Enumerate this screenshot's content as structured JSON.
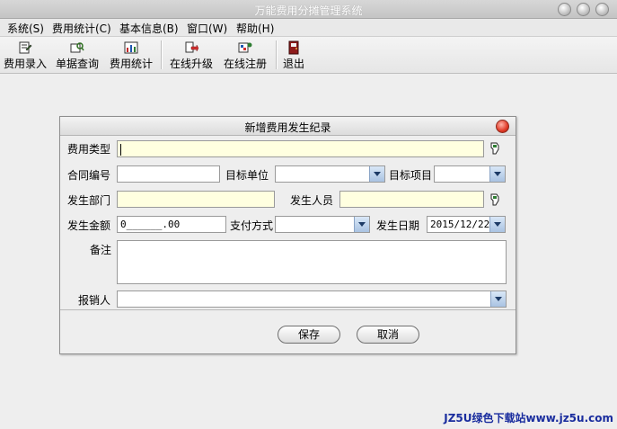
{
  "window": {
    "title": "万能费用分摊管理系统"
  },
  "menu": [
    {
      "label": "系统(S)"
    },
    {
      "label": "费用统计(C)"
    },
    {
      "label": "基本信息(B)"
    },
    {
      "label": "窗口(W)"
    },
    {
      "label": "帮助(H)"
    }
  ],
  "toolbar": [
    {
      "label": "费用录入",
      "icon": "expense-entry-icon"
    },
    {
      "label": "单据查询",
      "icon": "document-query-icon"
    },
    {
      "label": "费用统计",
      "icon": "expense-stats-icon"
    },
    {
      "label": "在线升级",
      "icon": "online-upgrade-icon"
    },
    {
      "label": "在线注册",
      "icon": "online-register-icon"
    },
    {
      "label": "退出",
      "icon": "exit-icon"
    }
  ],
  "dialog": {
    "title": "新增费用发生纪录",
    "fields": {
      "expense_type": {
        "label": "费用类型",
        "value": ""
      },
      "contract_no": {
        "label": "合同编号",
        "value": ""
      },
      "target_unit": {
        "label": "目标单位",
        "value": ""
      },
      "target_project": {
        "label": "目标项目",
        "value": ""
      },
      "department": {
        "label": "发生部门",
        "value": ""
      },
      "person": {
        "label": "发生人员",
        "value": ""
      },
      "amount": {
        "label": "发生金额",
        "value": "0______.00"
      },
      "payment_method": {
        "label": "支付方式",
        "value": ""
      },
      "date": {
        "label": "发生日期",
        "value": "2015/12/22"
      },
      "note": {
        "label": "备注",
        "value": ""
      },
      "reimburser": {
        "label": "报销人",
        "value": ""
      }
    },
    "buttons": {
      "save": "保存",
      "cancel": "取消"
    }
  },
  "watermark": "JZ5U绿色下载站www.jz5u.com",
  "colors": {
    "required_field_bg": "#ffffe0",
    "close_button": "#e03a26",
    "watermark": "#1a2d9e"
  }
}
